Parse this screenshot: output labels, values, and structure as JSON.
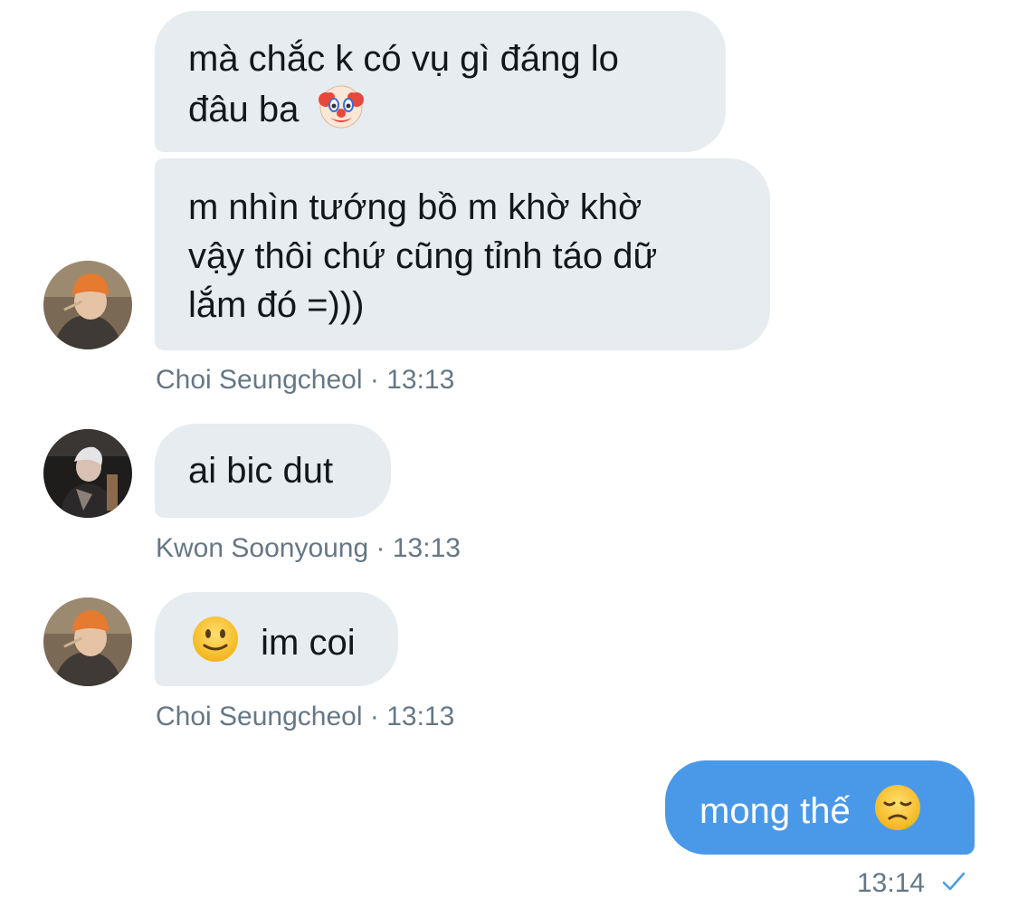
{
  "messages": [
    {
      "sender": "Choi Seungcheol",
      "direction": "in",
      "bubbles": [
        {
          "lines": [
            "mà chắc k có vụ gì đáng lo",
            "đâu ba"
          ],
          "trailing_icon": "clown-face-icon"
        },
        {
          "lines": [
            "m nhìn tướng bồ m khờ khờ",
            "vậy thôi chứ cũng tỉnh táo dữ",
            "lắm đó =)))"
          ]
        }
      ],
      "meta": {
        "name": "Choi Seungcheol",
        "separator": "·",
        "time": "13:13"
      }
    },
    {
      "sender": "Kwon Soonyoung",
      "direction": "in",
      "bubbles": [
        {
          "lines": [
            "ai bic dut"
          ]
        }
      ],
      "meta": {
        "name": "Kwon Soonyoung",
        "separator": "·",
        "time": "13:13"
      }
    },
    {
      "sender": "Choi Seungcheol",
      "direction": "in",
      "bubbles": [
        {
          "leading_icon": "slightly-smiling-face-icon",
          "lines": [
            "im coi"
          ]
        }
      ],
      "meta": {
        "name": "Choi Seungcheol",
        "separator": "·",
        "time": "13:13"
      }
    },
    {
      "sender": "me",
      "direction": "out",
      "bubbles": [
        {
          "lines": [
            "mong thế"
          ],
          "trailing_icon": "disappointed-face-icon"
        }
      ],
      "meta": {
        "time": "13:14",
        "status_icon": "checkmark-icon"
      }
    }
  ],
  "colors": {
    "incoming_bubble": "#e6ecf0",
    "outgoing_bubble": "#4a99e9",
    "meta_text": "#657786",
    "read_check": "#4a99e9"
  }
}
